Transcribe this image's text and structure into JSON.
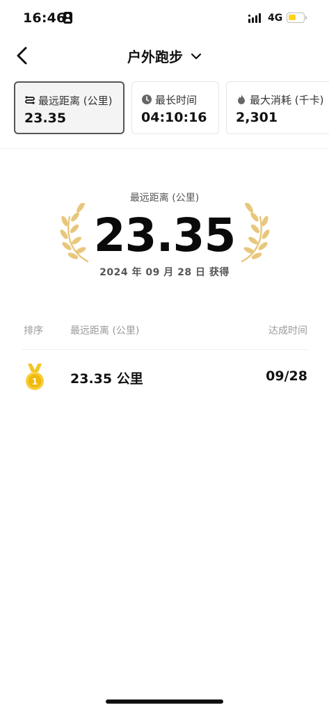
{
  "status_bar": {
    "time": "16:46",
    "network": "4G",
    "battery_color": "#ffd21f"
  },
  "nav": {
    "title": "户外跑步"
  },
  "tabs": [
    {
      "icon": "route-icon",
      "label": "最远距离 (公里)",
      "value": "23.35",
      "active": true
    },
    {
      "icon": "clock-icon",
      "label": "最长时间",
      "value": "04:10:16",
      "active": false
    },
    {
      "icon": "flame-icon",
      "label": "最大消耗 (千卡)",
      "value": "2,301",
      "active": false
    }
  ],
  "hero": {
    "label": "最远距离 (公里)",
    "value": "23.35",
    "date": "2024 年 09 月 28 日 获得",
    "laurel_color": "#e8c77d"
  },
  "table": {
    "headers": {
      "rank": "排序",
      "distance": "最远距离 (公里)",
      "time": "达成时间"
    },
    "rows": [
      {
        "rank_icon": "gold-medal-icon",
        "distance": "23.35 公里",
        "date": "09/28"
      }
    ]
  }
}
